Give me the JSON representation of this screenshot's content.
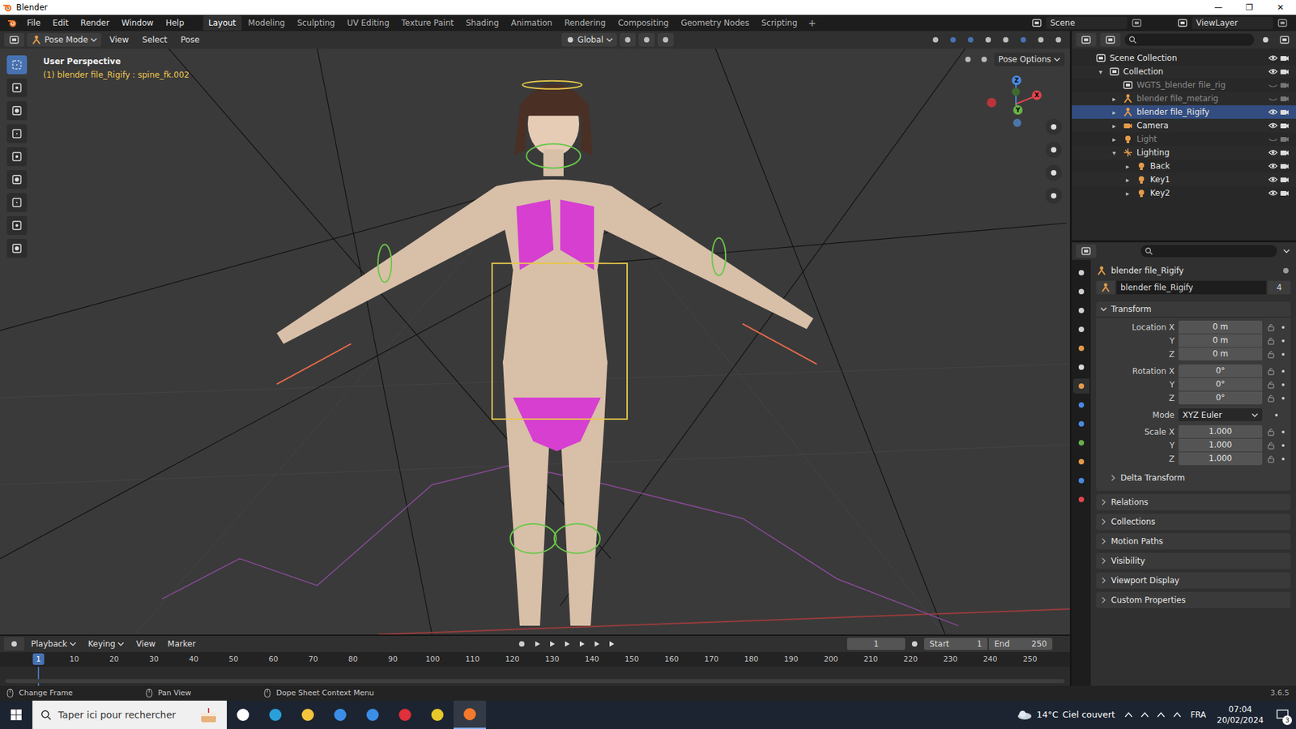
{
  "window": {
    "title": "Blender",
    "controls": [
      "—",
      "❐",
      "✕"
    ]
  },
  "menu": [
    "File",
    "Edit",
    "Render",
    "Window",
    "Help"
  ],
  "workspaces": [
    {
      "label": "Layout",
      "selected": true
    },
    {
      "label": "Modeling",
      "selected": false
    },
    {
      "label": "Sculpting",
      "selected": false
    },
    {
      "label": "UV Editing",
      "selected": false
    },
    {
      "label": "Texture Paint",
      "selected": false
    },
    {
      "label": "Shading",
      "selected": false
    },
    {
      "label": "Animation",
      "selected": false
    },
    {
      "label": "Rendering",
      "selected": false
    },
    {
      "label": "Compositing",
      "selected": false
    },
    {
      "label": "Geometry Nodes",
      "selected": false
    },
    {
      "label": "Scripting",
      "selected": false
    }
  ],
  "add_workspace": "+",
  "scene": "Scene",
  "view_layer": "ViewLayer",
  "viewport_header": {
    "mode": "Pose Mode",
    "menus": [
      "View",
      "Select",
      "Pose"
    ],
    "orientation": "Global",
    "pose_options": "Pose Options"
  },
  "viewport": {
    "perspective": "User Perspective",
    "active_bone": "(1) blender file_Rigify : spine_fk.002",
    "gizmo_labels": [
      "X",
      "Y",
      "Z"
    ]
  },
  "outliner": {
    "items": [
      {
        "label": "Scene Collection",
        "depth": 0,
        "arrow": "",
        "kind": "scene",
        "hidden": false,
        "selected": false
      },
      {
        "label": "Collection",
        "depth": 1,
        "arrow": "▾",
        "kind": "collection",
        "hidden": false,
        "selected": false
      },
      {
        "label": "WGTS_blender file_rig",
        "depth": 2,
        "arrow": "",
        "kind": "collection",
        "hidden": true,
        "selected": false
      },
      {
        "label": "blender file_metarig",
        "depth": 2,
        "arrow": "▸",
        "kind": "armature",
        "hidden": true,
        "selected": false
      },
      {
        "label": "blender file_Rigify",
        "depth": 2,
        "arrow": "▸",
        "kind": "armature",
        "hidden": false,
        "selected": true
      },
      {
        "label": "Camera",
        "depth": 2,
        "arrow": "▸",
        "kind": "camera",
        "hidden": false,
        "selected": false
      },
      {
        "label": "Light",
        "depth": 2,
        "arrow": "▸",
        "kind": "light",
        "hidden": true,
        "selected": false
      },
      {
        "label": "Lighting",
        "depth": 2,
        "arrow": "▾",
        "kind": "empty",
        "hidden": false,
        "selected": false
      },
      {
        "label": "Back",
        "depth": 3,
        "arrow": "▸",
        "kind": "light",
        "hidden": false,
        "selected": false
      },
      {
        "label": "Key1",
        "depth": 3,
        "arrow": "▸",
        "kind": "light",
        "hidden": false,
        "selected": false
      },
      {
        "label": "Key2",
        "depth": 3,
        "arrow": "▸",
        "kind": "light",
        "hidden": false,
        "selected": false
      }
    ]
  },
  "properties": {
    "object_name": "blender file_Rigify",
    "datablock": "blender file_Rigify",
    "users": "4",
    "transform_title": "Transform",
    "groups": [
      {
        "label": "Location",
        "rows": [
          {
            "axis": "X",
            "value": "0 m"
          },
          {
            "axis": "Y",
            "value": "0 m"
          },
          {
            "axis": "Z",
            "value": "0 m"
          }
        ]
      },
      {
        "label": "Rotation",
        "rows": [
          {
            "axis": "X",
            "value": "0°"
          },
          {
            "axis": "Y",
            "value": "0°"
          },
          {
            "axis": "Z",
            "value": "0°"
          }
        ]
      },
      {
        "label": "Scale",
        "rows": [
          {
            "axis": "X",
            "value": "1.000"
          },
          {
            "axis": "Y",
            "value": "1.000"
          },
          {
            "axis": "Z",
            "value": "1.000"
          }
        ]
      }
    ],
    "mode_label": "Mode",
    "mode": "XYZ Euler",
    "panels": [
      {
        "label": "Delta Transform",
        "kind": "subpanel"
      },
      {
        "label": "Relations",
        "kind": "panel"
      },
      {
        "label": "Collections",
        "kind": "panel"
      },
      {
        "label": "Motion Paths",
        "kind": "panel"
      },
      {
        "label": "Visibility",
        "kind": "panel"
      },
      {
        "label": "Viewport Display",
        "kind": "panel"
      },
      {
        "label": "Custom Properties",
        "kind": "panel"
      }
    ]
  },
  "timeline": {
    "menus": [
      "Playback",
      "Keying",
      "View",
      "Marker"
    ],
    "current_frame": "1",
    "start_label": "Start",
    "start": "1",
    "end_label": "End",
    "end": "250",
    "playhead": "1",
    "ticks": [
      "10",
      "20",
      "30",
      "40",
      "50",
      "60",
      "70",
      "80",
      "90",
      "100",
      "110",
      "120",
      "130",
      "140",
      "150",
      "160",
      "170",
      "180",
      "190",
      "200",
      "210",
      "220",
      "230",
      "240",
      "250"
    ]
  },
  "status_bar": {
    "hints": [
      "Change Frame",
      "Pan View",
      "Dope Sheet Context Menu"
    ],
    "version": "3.6.5"
  },
  "taskbar": {
    "search_placeholder": "Taper ici pour rechercher",
    "weather_temp": "14°C",
    "weather_text": "Ciel couvert",
    "language": "FRA",
    "time": "07:04",
    "date": "20/02/2024",
    "notifications": "3"
  }
}
